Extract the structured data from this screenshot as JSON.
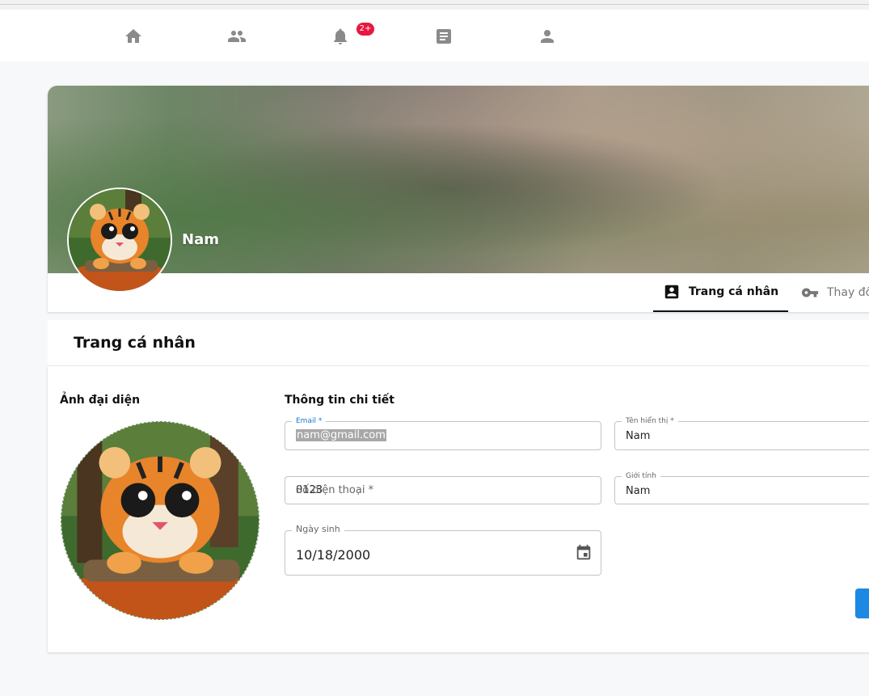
{
  "nav": {
    "items": [
      {
        "icon": "home-icon"
      },
      {
        "icon": "friends-icon"
      },
      {
        "icon": "bell-icon",
        "badge": "2+"
      },
      {
        "icon": "article-icon"
      },
      {
        "icon": "person-icon"
      }
    ]
  },
  "profile": {
    "display_name": "Nam",
    "tabs": [
      {
        "label": "Trang cá nhân",
        "icon": "contact-card-icon",
        "active": true
      },
      {
        "label": "Thay đổ",
        "icon": "key-icon",
        "active": false
      }
    ]
  },
  "section": {
    "title": "Trang cá nhân",
    "avatar_label": "Ảnh đại diện",
    "detail_label": "Thông tin chi tiết"
  },
  "form": {
    "email_label": "Email *",
    "email_value": "nam@gmail.com",
    "name_label": "Tên hiển thị *",
    "name_value": "Nam",
    "phone_label": "Số điện thoại *",
    "phone_value": "0123",
    "gender_label": "Giới tính",
    "gender_value": "Nam",
    "dob_label": "Ngày sinh",
    "dob_value": "10/18/2000"
  },
  "colors": {
    "badge": "#e8173f",
    "accent": "#1976d2",
    "save_button": "#1e88e5"
  }
}
